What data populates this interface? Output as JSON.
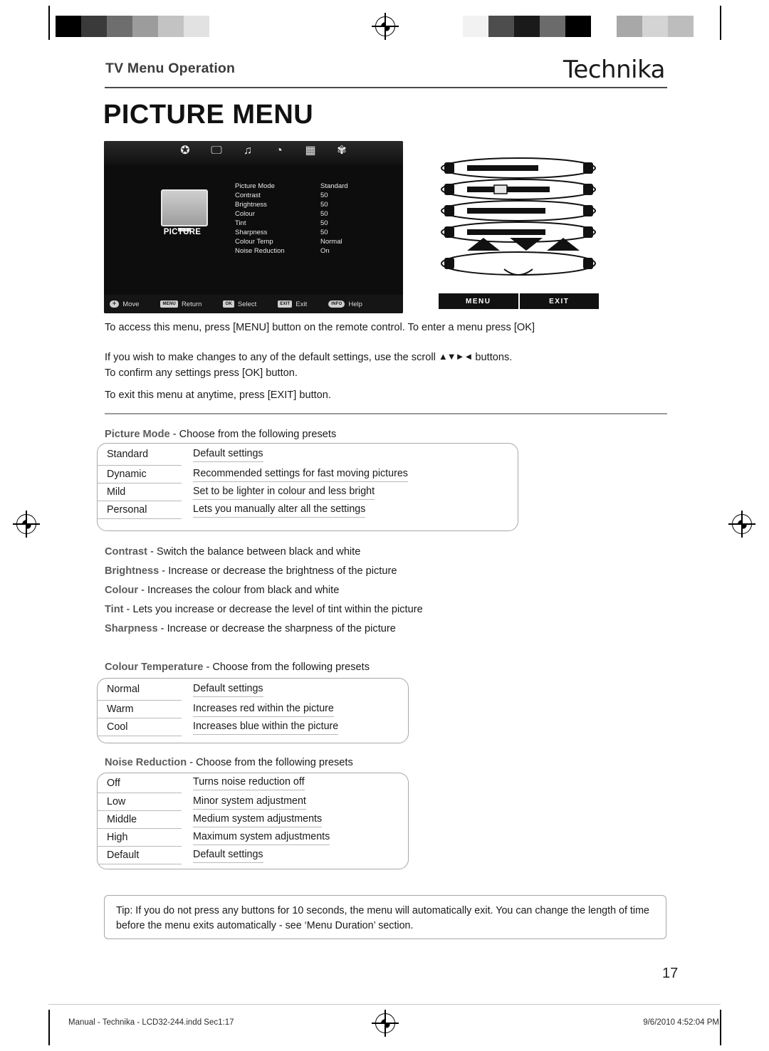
{
  "header": {
    "section_title": "TV Menu Operation",
    "brand": "Technika",
    "page_title": "PICTURE MENU"
  },
  "osd": {
    "icons": [
      "sports-icon",
      "tv-icon",
      "music-icon",
      "clock-icon",
      "grid-icon",
      "gear-icon"
    ],
    "icon_glyphs": [
      "✪",
      "🖵",
      "♫",
      "◔",
      "▦",
      "✾"
    ],
    "category_label": "PICTURE",
    "rows": [
      {
        "key": "Picture Mode",
        "value": "Standard"
      },
      {
        "key": "Contrast",
        "value": "50"
      },
      {
        "key": "Brightness",
        "value": "50"
      },
      {
        "key": "Colour",
        "value": "50"
      },
      {
        "key": "Tint",
        "value": "50"
      },
      {
        "key": "Sharpness",
        "value": "50"
      },
      {
        "key": "Colour Temp",
        "value": "Normal"
      },
      {
        "key": "Noise Reduction",
        "value": "On"
      }
    ],
    "footer": [
      {
        "chip": "",
        "label": "Move"
      },
      {
        "chip": "MENU",
        "label": "Return"
      },
      {
        "chip": "OK",
        "label": "Select"
      },
      {
        "chip": "EXIT",
        "label": "Exit"
      },
      {
        "chip": "INFO",
        "label": "Help"
      }
    ]
  },
  "remote": {
    "menu_button": "MENU",
    "exit_button": "EXIT"
  },
  "instructions": {
    "p1": "To access this menu, press [MENU] button on the remote control. To enter a menu press [OK]",
    "p2_before": "If you wish to make changes to any of the default settings, use the scroll",
    "p2_arrows": "▲▼►◄",
    "p2_after": "buttons.",
    "p2_line2": "To confirm any settings press [OK] button.",
    "p3": "To exit this menu at anytime, press [EXIT] button."
  },
  "picture_mode": {
    "heading_bold": "Picture Mode",
    "heading_rest": " - Choose from the following presets",
    "rows": [
      {
        "name": "Standard",
        "desc": "Default settings"
      },
      {
        "name": "Dynamic",
        "desc": "Recommended settings for fast moving pictures"
      },
      {
        "name": "Mild",
        "desc": "Set to be lighter in colour and less bright"
      },
      {
        "name": "Personal",
        "desc": "Lets you manually alter all the settings"
      }
    ]
  },
  "definitions": [
    {
      "term": "Contrast",
      "desc": " - Switch the balance between black and white"
    },
    {
      "term": "Brightness",
      "desc": " - Increase or decrease the brightness of the picture"
    },
    {
      "term": "Colour",
      "desc": " - Increases the colour from black and white"
    },
    {
      "term": "Tint",
      "desc": " - Lets you increase or decrease the level of tint within the picture"
    },
    {
      "term": "Sharpness",
      "desc": " - Increase or decrease the sharpness of the picture"
    }
  ],
  "colour_temperature": {
    "heading_bold": "Colour Temperature",
    "heading_rest": " - Choose from the following presets",
    "rows": [
      {
        "name": "Normal",
        "desc": "Default settings"
      },
      {
        "name": "Warm",
        "desc": "Increases red within the picture"
      },
      {
        "name": "Cool",
        "desc": "Increases blue within the picture"
      }
    ]
  },
  "noise_reduction": {
    "heading_bold": "Noise Reduction",
    "heading_rest": " - Choose from the following presets",
    "rows": [
      {
        "name": "Off",
        "desc": "Turns noise reduction off"
      },
      {
        "name": "Low",
        "desc": "Minor system adjustment"
      },
      {
        "name": "Middle",
        "desc": "Medium system adjustments"
      },
      {
        "name": "High",
        "desc": "Maximum system adjustments"
      },
      {
        "name": "Default",
        "desc": "Default settings"
      }
    ]
  },
  "tip": {
    "line1": "Tip: If you do not press any buttons for 10 seconds, the menu will automatically exit. You can change the",
    "line2": "length of time before the menu exits automatically - see ‘Menu Duration’ section."
  },
  "page_number": "17",
  "footer": {
    "left": "Manual - Technika - LCD32-244.indd   Sec1:17",
    "right": "9/6/2010   4:52:04 PM"
  },
  "colors": {
    "heading_gray": "#5b5b5b",
    "rule_gray": "#9a9a9a",
    "table_border": "#a8a8a8",
    "osd_bg": "#0d0d0d"
  }
}
